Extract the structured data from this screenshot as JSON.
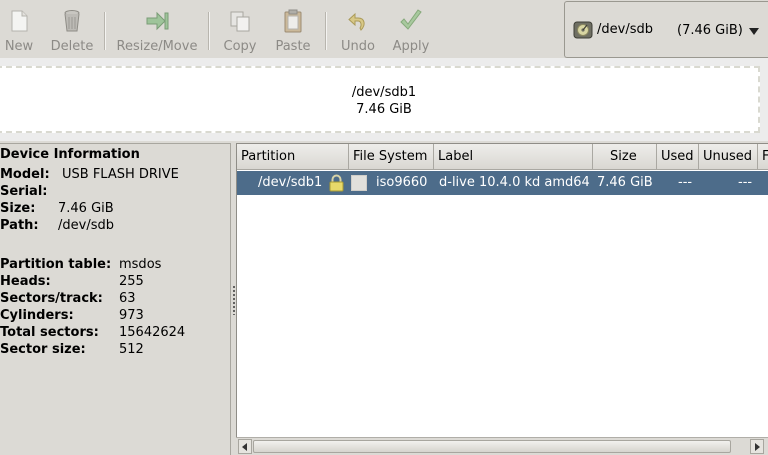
{
  "toolbar": {
    "new_label": "New",
    "delete_label": "Delete",
    "resize_label": "Resize/Move",
    "copy_label": "Copy",
    "paste_label": "Paste",
    "undo_label": "Undo",
    "apply_label": "Apply"
  },
  "device_selector": {
    "device": "/dev/sdb",
    "size": "(7.46 GiB)"
  },
  "graph": {
    "partition_name": "/dev/sdb1",
    "partition_size": "7.46 GiB"
  },
  "device_info": {
    "title": "Device Information",
    "model_label": "Model:",
    "model_value": "USB FLASH DRIVE",
    "serial_label": "Serial:",
    "serial_value": "",
    "size_label": "Size:",
    "size_value": "7.46 GiB",
    "path_label": "Path:",
    "path_value": "/dev/sdb",
    "partition_table_label": "Partition table:",
    "partition_table_value": "msdos",
    "heads_label": "Heads:",
    "heads_value": "255",
    "sectors_track_label": "Sectors/track:",
    "sectors_track_value": "63",
    "cylinders_label": "Cylinders:",
    "cylinders_value": "973",
    "total_sectors_label": "Total sectors:",
    "total_sectors_value": "15642624",
    "sector_size_label": "Sector size:",
    "sector_size_value": "512"
  },
  "table": {
    "columns": {
      "partition": "Partition",
      "filesystem": "File System",
      "label": "Label",
      "size": "Size",
      "used": "Used",
      "unused": "Unused",
      "flags": "F"
    },
    "rows": [
      {
        "partition": "/dev/sdb1",
        "filesystem": "iso9660",
        "label": "d-live 10.4.0 kd amd64",
        "size": "7.46 GiB",
        "used": "---",
        "unused": "---"
      }
    ]
  },
  "colors": {
    "selection": "#4d6c8a",
    "window_bg": "#dcdad5",
    "disabled_text": "#8c8a86"
  }
}
